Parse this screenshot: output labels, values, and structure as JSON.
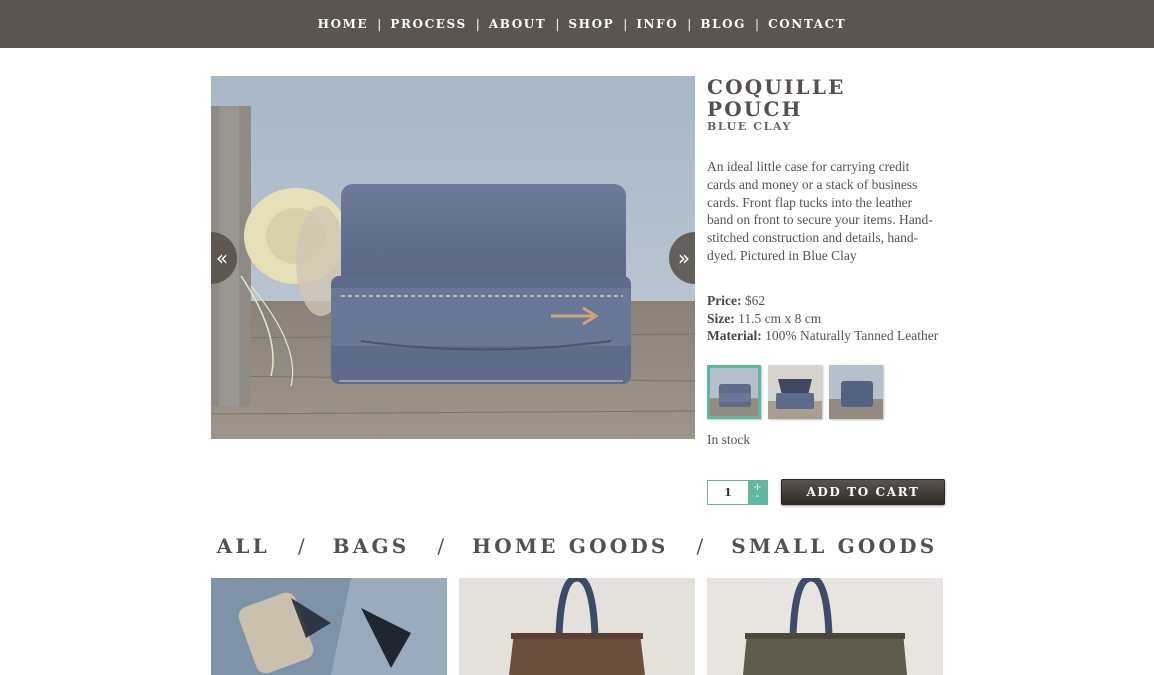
{
  "nav": {
    "items": [
      "HOME",
      "PROCESS",
      "ABOUT",
      "SHOP",
      "INFO",
      "BLOG",
      "CONTACT"
    ],
    "separator": "|"
  },
  "product": {
    "title": "COQUILLE POUCH",
    "subtitle": "BLUE CLAY",
    "description": "An ideal little case for carrying credit cards and money or a stack of business cards.  Front flap tucks into the leather band on front to secure your items. Hand-stitched construction and details, hand-dyed. Pictured in Blue Clay",
    "price_label": "Price:",
    "price_value": "$62",
    "size_label": "Size:",
    "size_value": "11.5 cm x 8 cm",
    "material_label": "Material:",
    "material_value": "100% Naturally Tanned Leather",
    "stock": "In stock",
    "quantity": "1",
    "add_to_cart": "ADD TO CART",
    "prev_icon": "«",
    "next_icon": "»"
  },
  "categories": {
    "items": [
      "ALL",
      "BAGS",
      "HOME GOODS",
      "SMALL GOODS"
    ],
    "separator": "/"
  },
  "colors": {
    "nav_bg": "#5b544f",
    "accent_teal": "#62b6a1",
    "text_dark": "#55504b",
    "button_bg": "#3f3a36"
  }
}
